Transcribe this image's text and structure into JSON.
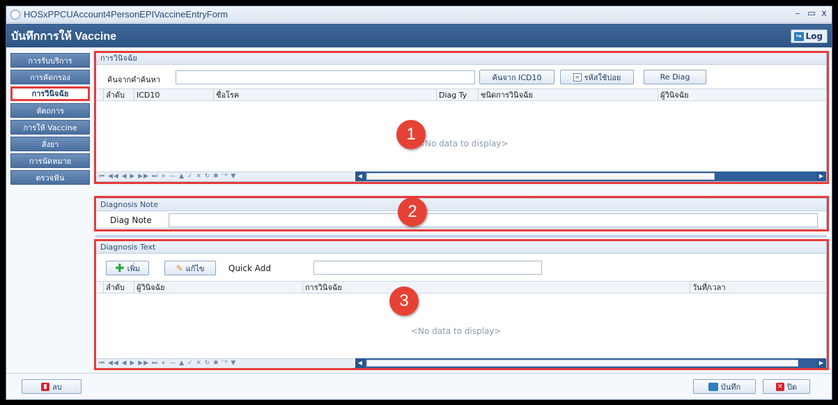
{
  "window": {
    "title": "HOSxPPCUAccount4PersonEPIVaccineEntryForm",
    "minimize": "–",
    "maximize": "▭",
    "close": "x"
  },
  "header": {
    "title": "บันทึกการให้ Vaccine",
    "log_label": "Log"
  },
  "sidebar": {
    "items": [
      {
        "label": "การรับบริการ"
      },
      {
        "label": "การคัดกรอง"
      },
      {
        "label": "การวินิจฉัย",
        "active": true
      },
      {
        "label": "หัตถการ"
      },
      {
        "label": "การให้ Vaccine"
      },
      {
        "label": "สั่งยา"
      },
      {
        "label": "การนัดหมาย"
      },
      {
        "label": "ตรวจฟัน"
      }
    ]
  },
  "diagnosis": {
    "title": "การวินิจฉัย",
    "search_label": "ค้นจากคำค้นหา",
    "search_value": "",
    "btn_icd10": "ค้นจาก ICD10",
    "btn_frequent": "รหัสใช้บ่อย",
    "btn_rediag": "Re Diag",
    "columns": [
      "ลำดับ",
      "ICD10",
      "ชื่อโรค",
      "Diag Ty",
      "ชนิดการวินิจฉัย",
      "ผู้วินิจฉัย"
    ],
    "nodata": "<No data to display>"
  },
  "note": {
    "title": "Diagnosis Note",
    "label": "Diag Note",
    "value": ""
  },
  "text": {
    "title": "Diagnosis Text",
    "btn_add": "เพิ่ม",
    "btn_edit": "แก้ไข",
    "quick_add_label": "Quick Add",
    "quick_add_value": "",
    "columns": [
      "ลำดับ",
      "ผู้วินิจฉัย",
      "การวินิจฉัย",
      "วันที่/เวลา"
    ],
    "nodata": "<No data to display>"
  },
  "nav_icons": "⏮ ◀◀ ◀ ▶ ▶▶ ⏭ + — ▲ ✓ ✕ ↻ ✱ '* ▼",
  "badges": {
    "one": "1",
    "two": "2",
    "three": "3"
  },
  "footer": {
    "delete_label": "ลบ",
    "save_label": "บันทึก",
    "close_label": "ปิด"
  },
  "colors": {
    "header": "#2d5485",
    "highlight": "#e63b3b",
    "badge": "#e54235"
  }
}
